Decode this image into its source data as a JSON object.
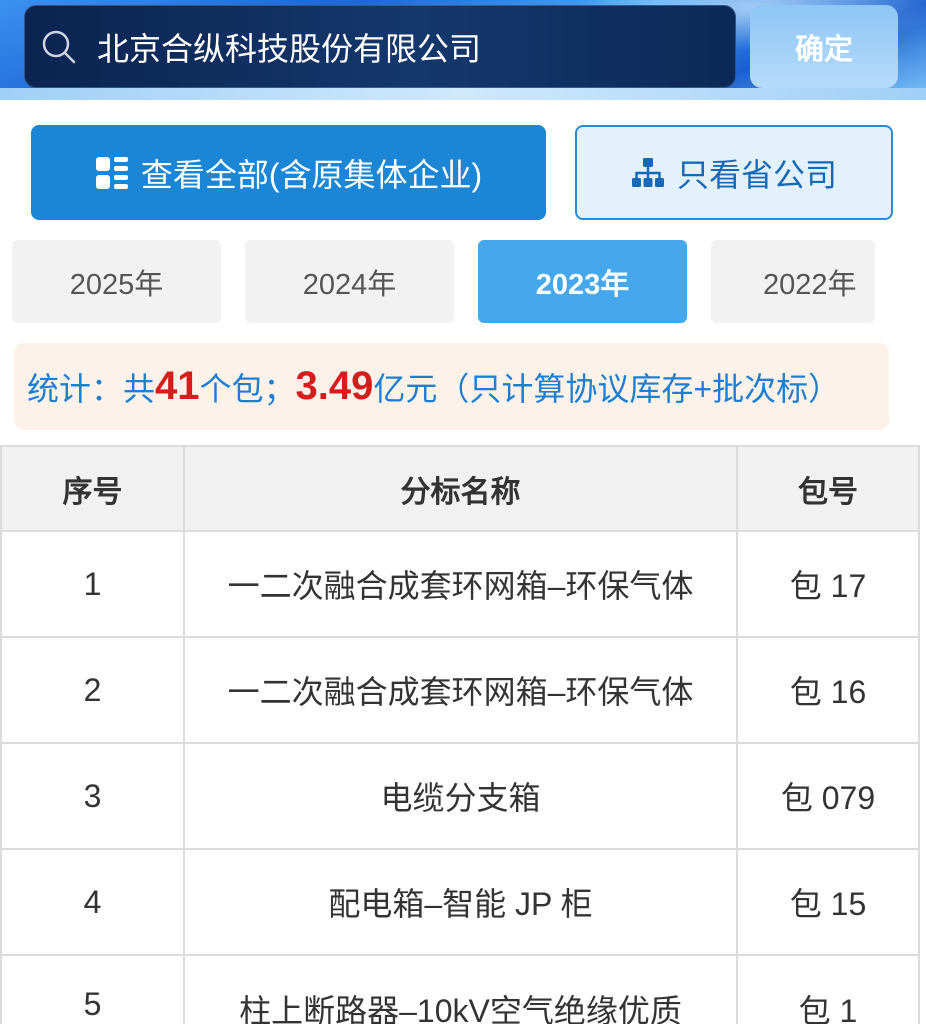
{
  "search": {
    "value": "北京合纵科技股份有限公司",
    "icon": "search-icon",
    "confirm_label": "确定"
  },
  "filters": {
    "all": {
      "label": "查看全部(含原集体企业)",
      "icon": "grid-icon",
      "active": true
    },
    "province": {
      "label": "只看省公司",
      "icon": "org-chart-icon",
      "active": false
    }
  },
  "years": [
    {
      "label": "2025年",
      "selected": false
    },
    {
      "label": "2024年",
      "selected": false
    },
    {
      "label": "2023年",
      "selected": true
    },
    {
      "label": "2022年",
      "selected": false
    }
  ],
  "stats": {
    "prefix": "统计：共",
    "package_count": "41",
    "package_unit": "个包；",
    "amount": "3.49",
    "suffix": "亿元（只计算协议库存+批次标）"
  },
  "table": {
    "headers": [
      "序号",
      "分标名称",
      "包号"
    ],
    "rows": [
      {
        "index": "1",
        "name": "一二次融合成套环网箱–环保气体",
        "package": "包 17"
      },
      {
        "index": "2",
        "name": "一二次融合成套环网箱–环保气体",
        "package": "包 16"
      },
      {
        "index": "3",
        "name": "电缆分支箱",
        "package": "包 079"
      },
      {
        "index": "4",
        "name": "配电箱–智能 JP 柜",
        "package": "包 15"
      },
      {
        "index": "5",
        "name": "柱上断路器–10kV空气绝缘优质",
        "package": "包 1"
      }
    ]
  },
  "colors": {
    "primary": "#1a86d5",
    "tab_selected": "#45a8ec",
    "highlight_red": "#d41e1e",
    "stats_text": "#1e7fd2",
    "stats_bg": "#fdf2ea",
    "search_bg": "#0b2350"
  }
}
